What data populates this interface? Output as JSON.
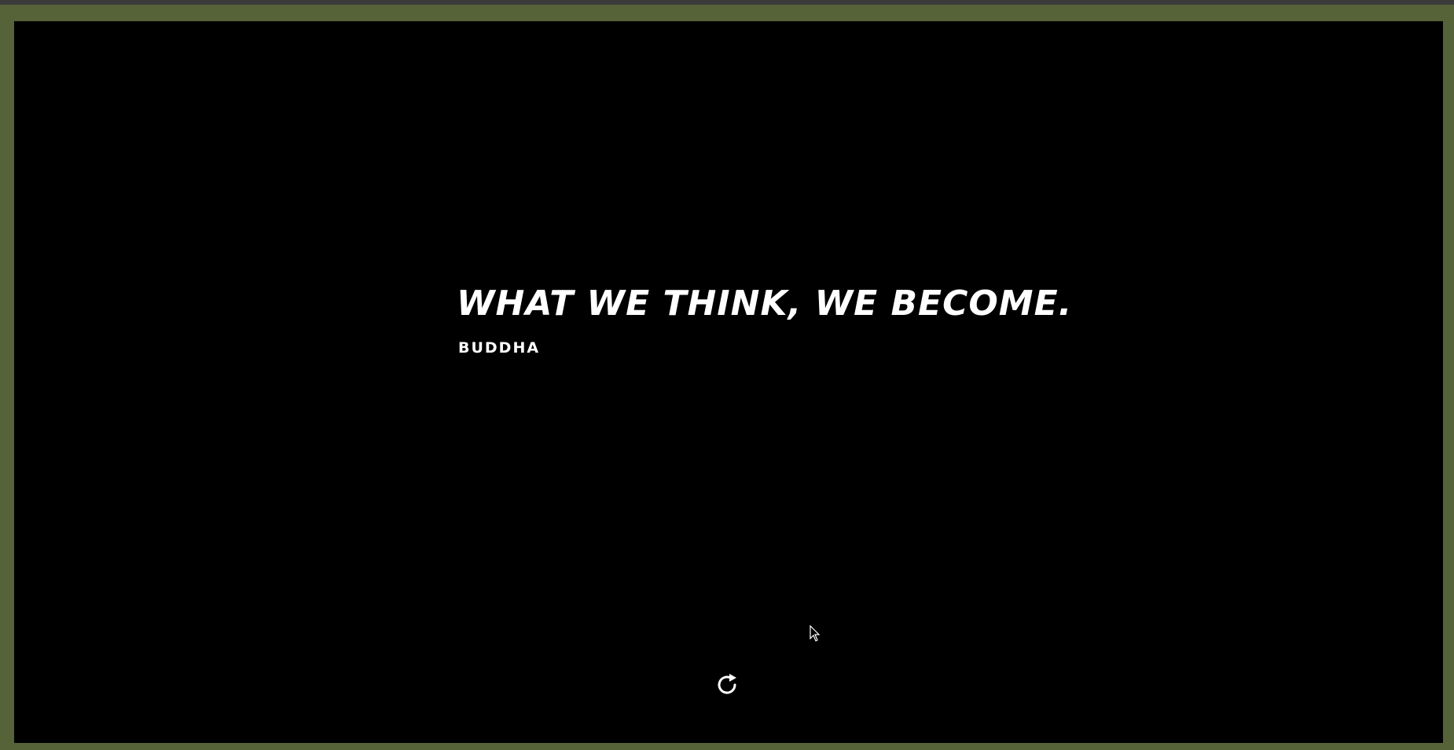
{
  "quote": {
    "text": "WHAT WE THINK, WE BECOME.",
    "author": "BUDDHA"
  },
  "controls": {
    "refresh_icon": "refresh-icon"
  },
  "colors": {
    "frame": "#566237",
    "screen_background": "#000000",
    "text": "#ffffff"
  }
}
